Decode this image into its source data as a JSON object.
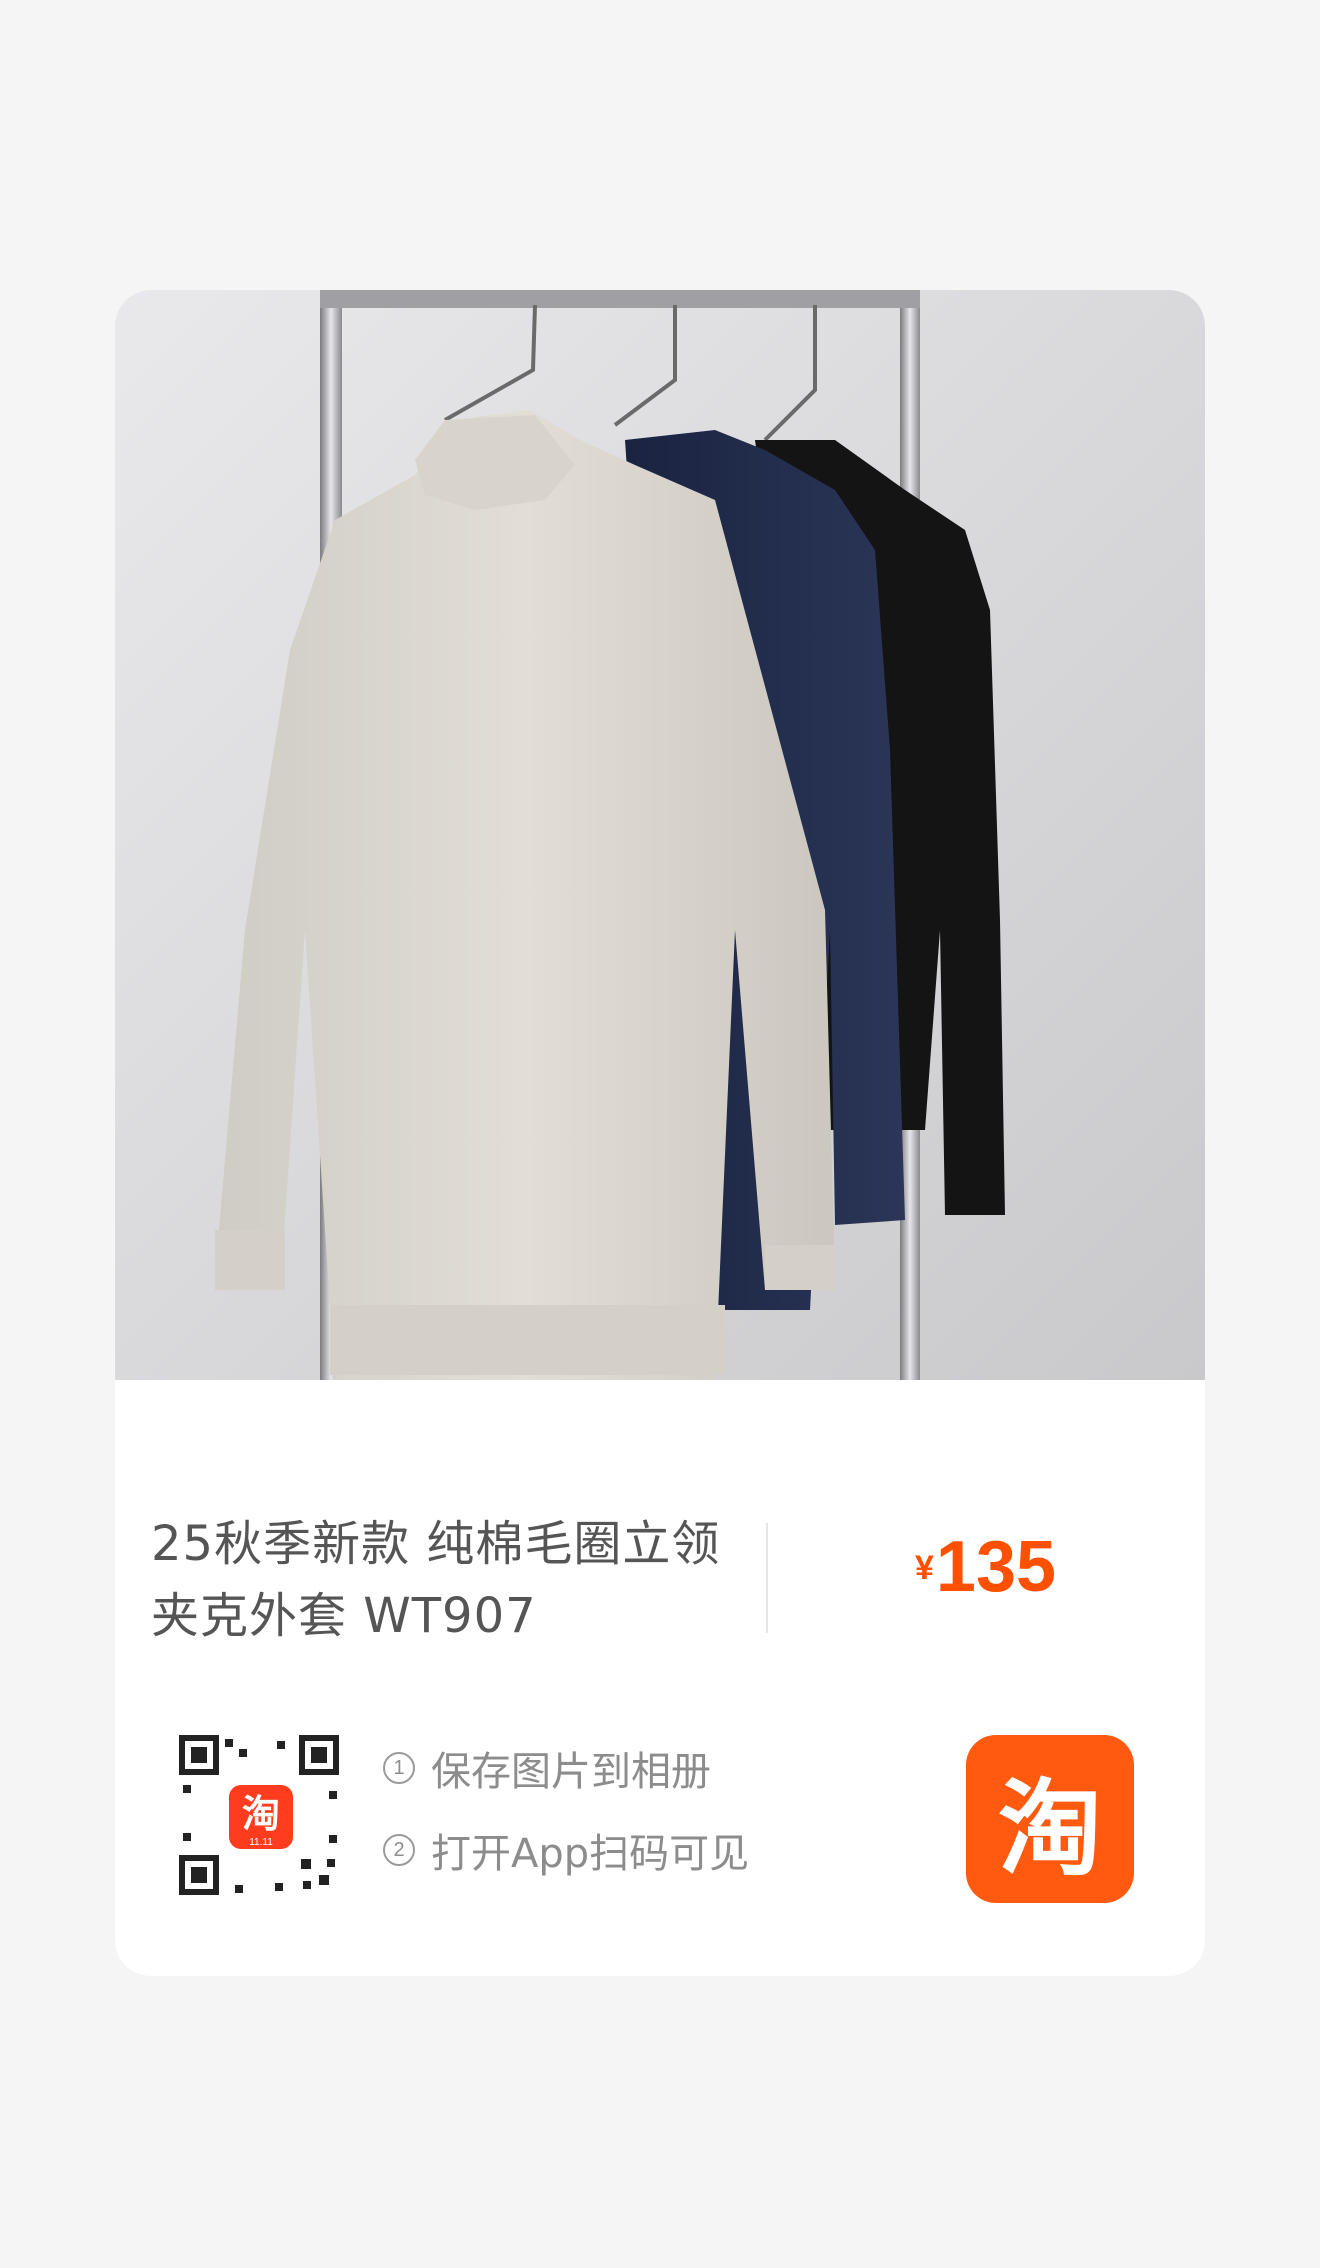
{
  "product": {
    "title_line1": "25秋季新款 纯棉毛圈立领",
    "title_line2": "夹克外套 WT907",
    "price_currency": "¥",
    "price_value": "135"
  },
  "instructions": {
    "step1_num": "1",
    "step1_text": "保存图片到相册",
    "step2_num": "2",
    "step2_text": "打开App扫码可见"
  },
  "branding": {
    "logo_char": "淘",
    "qr_badge_char": "淘",
    "qr_badge_sub": "11.11"
  },
  "colors": {
    "accent": "#ff5000",
    "logo_bg": "#ff5a10",
    "page_bg": "#f5f5f5"
  },
  "icons": {
    "product_image": "hanging-jackets-photo",
    "qr": "qr-code-icon",
    "logo": "taobao-logo-icon"
  }
}
